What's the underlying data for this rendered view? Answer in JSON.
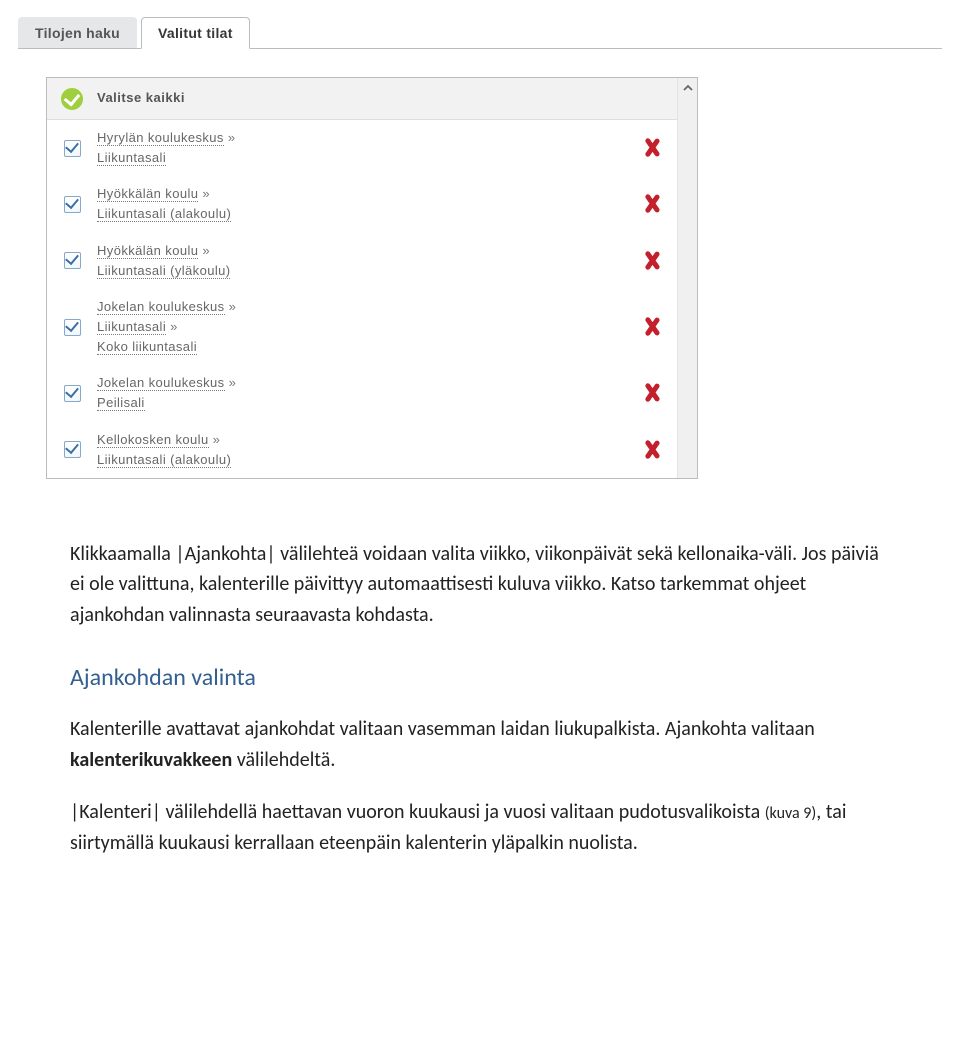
{
  "tabs": {
    "search_tab": "Tilojen haku",
    "selected_tab": "Valitut tilat"
  },
  "list": {
    "select_all": "Valitse kaikki",
    "separator": " »",
    "items": [
      {
        "lines": [
          "Hyrylän koulukeskus",
          "Liikuntasali"
        ]
      },
      {
        "lines": [
          "Hyökkälän koulu",
          "Liikuntasali (alakoulu)"
        ]
      },
      {
        "lines": [
          "Hyökkälän koulu",
          "Liikuntasali (yläkoulu)"
        ]
      },
      {
        "lines": [
          "Jokelan koulukeskus",
          "Liikuntasali",
          "Koko liikuntasali"
        ]
      },
      {
        "lines": [
          "Jokelan koulukeskus",
          "Peilisali"
        ]
      },
      {
        "lines": [
          "Kellokosken koulu",
          "Liikuntasali (alakoulu)"
        ]
      }
    ]
  },
  "doc": {
    "p1a": "Klikkaamalla |Ajankohta| välilehteä voidaan valita viikko, viikonpäivät sekä kellonaika-väli. Jos päiviä ei ole valittuna, kalenterille päivittyy automaattisesti kuluva viikko. Katso tarkemmat ohjeet ajankohdan valinnasta seuraavasta kohdasta.",
    "heading": "Ajankohdan valinta",
    "p2_pre": "Kalenterille avattavat ajankohdat valitaan vasemman laidan liukupalkista. Ajankohta valitaan ",
    "p2_strong": "kalenterikuvakkeen",
    "p2_post": " välilehdeltä.",
    "p3_pre": "|Kalenteri| välilehdellä haettavan vuoron kuukausi ja vuosi valitaan pudotusvalikoista ",
    "p3_small": "(kuva 9)",
    "p3_post": ", tai siirtymällä kuukausi kerrallaan eteenpäin kalenterin yläpalkin nuolista."
  }
}
